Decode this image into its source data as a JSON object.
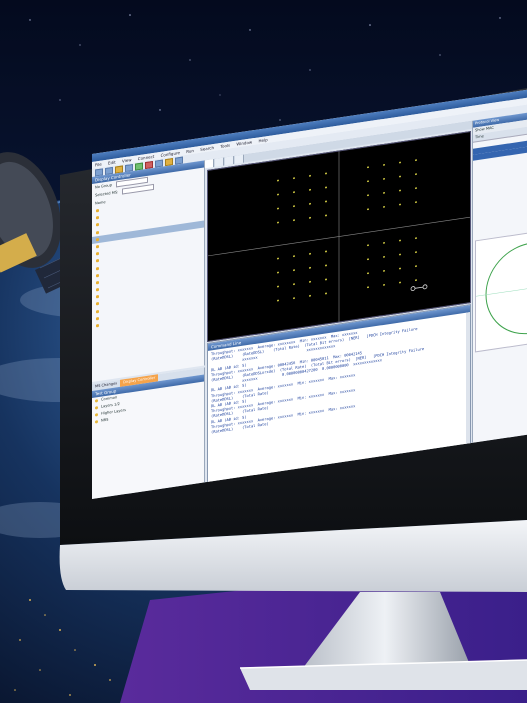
{
  "app": {
    "title": "",
    "menu": [
      "File",
      "Edit",
      "View",
      "Connect",
      "Configure",
      "Run",
      "Search",
      "Tools",
      "Window",
      "Help"
    ],
    "left_panel": {
      "title": "Display Controller",
      "group_label": "No Group",
      "selected_label": "Selected MS:",
      "name_col": "Name",
      "items": [
        "",
        "",
        "",
        "",
        "",
        "",
        "",
        "",
        "",
        "",
        "",
        "",
        "",
        "",
        "",
        "",
        ""
      ]
    },
    "left_bottom": {
      "tabs": [
        "MS Changes",
        "Display Controller"
      ],
      "title": "Test Group",
      "items": [
        "Common",
        "Layers 1/2",
        "Higher Layers",
        "NRS"
      ]
    },
    "doc_tabs": [
      "",
      "",
      "",
      ""
    ],
    "right_panel": {
      "title": "Protocol View",
      "filter": "Show MAC",
      "column": "Time",
      "rows": [
        "",
        "",
        "",
        "",
        ""
      ]
    },
    "command_window": {
      "title": "Command Line",
      "lines": [
        "Throughput: xxxxxxx  Average: xxxxxxxx  Min: xxxxxxx  Max: xxxxxxx",
        "(RateDDSL)    (RateDDSL)    (Total Rate)  (Total Bit errors)  [NER]   [PDCH Integrity Failure",
        "              xxxxxxx                      xxxxxxxxxxxxx",
        "",
        "DL AB (AB id: 5)",
        "Throughput: xxxxxxx  Average: 00042456  Min: 00045011  Max: 00042145",
        "(RateDDSL)    (RateDDSLorxde)  (Total Rate)  (Total Bit errors)  [NER]   [PDCH Integrity Failure",
        "              xxxxxxx           0.00000000427200  0.0000000000  xxxxxxxxxxxxx",
        "",
        "DL AB (AB id: 5)",
        "Throughput: xxxxxxx  Average: xxxxxxx  Min: xxxxxxx  Max: xxxxxxx",
        "(RateDDSL)    (Total Rate)",
        "",
        "DL AB (AB id: 5)",
        "Throughput: xxxxxxx  Average: xxxxxxx  Min: xxxxxxx  Max: xxxxxxx",
        "(RateDDSL)    (Total Rate)",
        "",
        "DL AB (AB id: 5)",
        "Throughput: xxxxxxx  Average: xxxxxxx  Min: xxxxxxx  Max: xxxxxxx",
        "(RateDDSL)    (Total Rate)"
      ]
    }
  },
  "colors": {
    "constellation_point": "#e8e04a",
    "axis_line": "#8a8a8a",
    "log_text": "#1b3f9c",
    "panel_header": "#3f6aa8",
    "active_tab": "#f5a34a",
    "purple_base": "#5a2b9c"
  }
}
